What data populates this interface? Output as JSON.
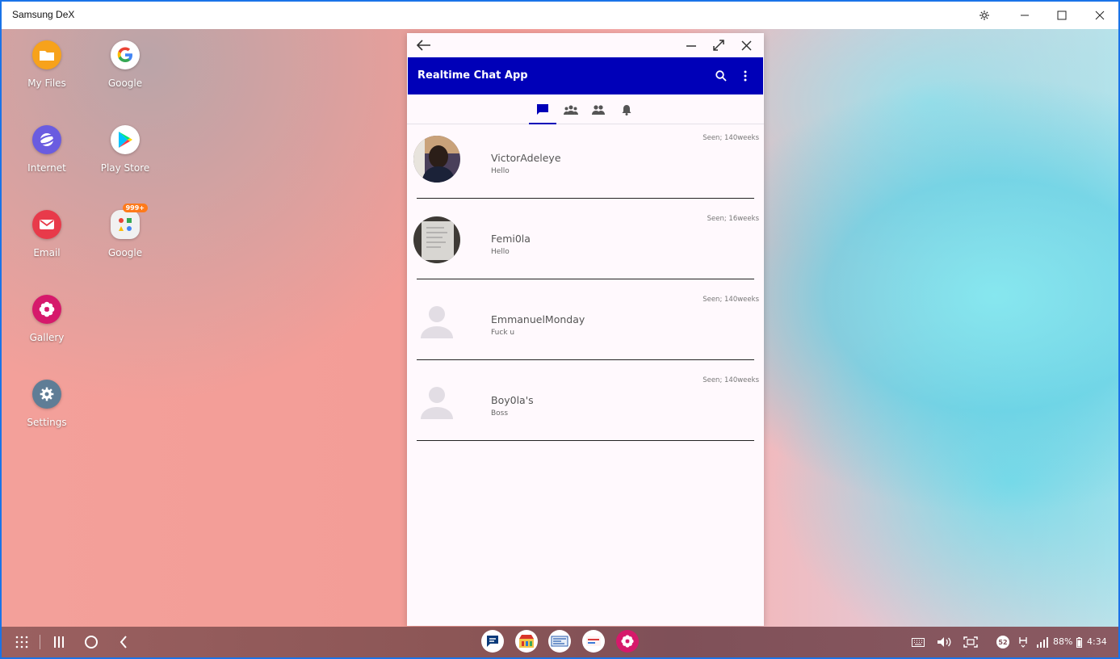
{
  "host": {
    "title": "Samsung DeX"
  },
  "desktop_apps": [
    {
      "label": "My Files",
      "icon": "folder-icon",
      "color": "#f7a21b"
    },
    {
      "label": "Google",
      "icon": "google-icon",
      "color": "#ffffff"
    },
    {
      "label": "Internet",
      "icon": "internet-icon",
      "color": "#6a5ce0"
    },
    {
      "label": "Play Store",
      "icon": "play-store-icon",
      "color": "#ffffff"
    },
    {
      "label": "Email",
      "icon": "email-icon",
      "color": "#e83a4a"
    },
    {
      "label": "Google",
      "icon": "google-folder-icon",
      "color": "#f1f1f1",
      "badge": "999+"
    },
    {
      "label": "Gallery",
      "icon": "gallery-icon",
      "color": "#d6196b"
    },
    {
      "label": "Settings",
      "icon": "settings-icon",
      "color": "#5f7d96"
    }
  ],
  "chat_app": {
    "title": "Realtime Chat App",
    "accent": "#0000b8",
    "tabs": [
      "chats-icon",
      "groups-icon",
      "friends-icon",
      "notifications-icon"
    ],
    "chats": [
      {
        "name": "VictorAdeleye",
        "message": "Hello",
        "seen": "Seen; 140weeks",
        "avatar": "photo"
      },
      {
        "name": "Femi0la",
        "message": "Hello",
        "seen": "Seen; 16weeks",
        "avatar": "photo"
      },
      {
        "name": "EmmanuelMonday",
        "message": "Fuck u",
        "seen": "Seen; 140weeks",
        "avatar": "placeholder"
      },
      {
        "name": "Boy0la's",
        "message": "Boss",
        "seen": "Seen; 140weeks",
        "avatar": "placeholder"
      }
    ]
  },
  "taskbar": {
    "battery": "88%",
    "time": "4:34",
    "notification_count": "52"
  }
}
